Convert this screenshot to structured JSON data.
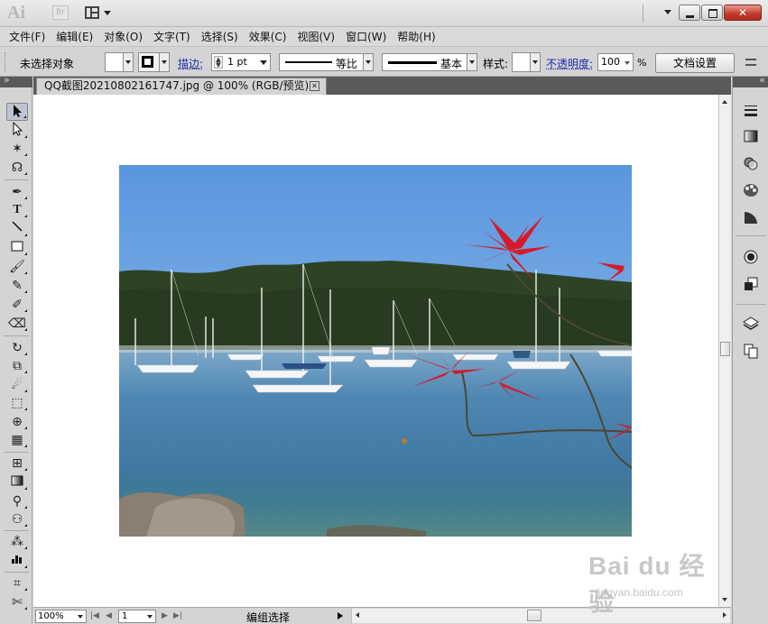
{
  "app": {
    "logo_text": "Ai",
    "bridge_label": "Br"
  },
  "menubar": {
    "items": [
      "文件(F)",
      "编辑(E)",
      "对象(O)",
      "文字(T)",
      "选择(S)",
      "效果(C)",
      "视图(V)",
      "窗口(W)",
      "帮助(H)"
    ]
  },
  "controlbar": {
    "selection_status": "未选择对象",
    "stroke_label": "描边:",
    "stroke_weight": "1 pt",
    "variable_width_profile": "等比",
    "brush_definition": "基本",
    "style_label": "样式:",
    "opacity_label": "不透明度:",
    "opacity_value": "100",
    "percent_sign": "%",
    "document_setup_label": "文档设置"
  },
  "document": {
    "tab_title": "QQ截图20210802161747.jpg @ 100% (RGB/预览)",
    "tab_close": "✕"
  },
  "statusbar": {
    "zoom": "100%",
    "page": "1",
    "status_text": "编组选择"
  },
  "watermark": {
    "logo": "Bai du 经验",
    "url": "jingyan.baidu.com"
  },
  "tools": [
    "selection-tool",
    "direct-selection-tool",
    "magic-wand-tool",
    "lasso-tool",
    "pen-tool",
    "type-tool",
    "line-segment-tool",
    "rectangle-tool",
    "paintbrush-tool",
    "pencil-tool",
    "blob-brush-tool",
    "eraser-tool",
    "rotate-tool",
    "scale-tool",
    "warp-tool",
    "free-transform-tool",
    "shape-builder-tool",
    "perspective-grid-tool",
    "mesh-tool",
    "gradient-tool",
    "eyedropper-tool",
    "blend-tool",
    "symbol-sprayer-tool",
    "column-graph-tool",
    "artboard-tool",
    "slice-tool"
  ],
  "colors": {
    "sky": "#6fa6e2",
    "water": "#3f79a8",
    "trees": "#2e4326",
    "flower": "#d61a2a"
  }
}
